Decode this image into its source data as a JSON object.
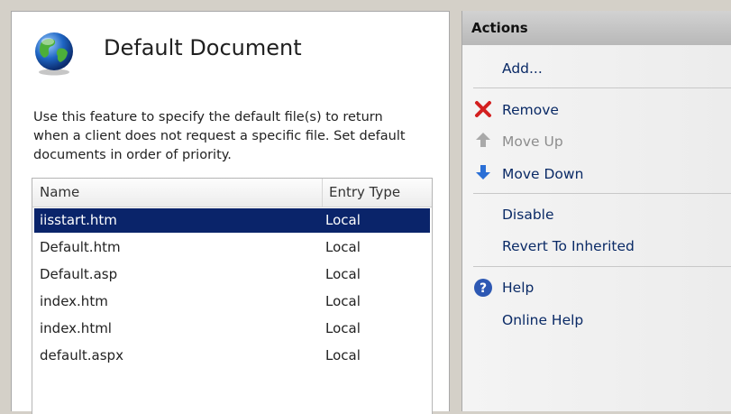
{
  "feature": {
    "title": "Default Document",
    "description_lines": [
      "Use this feature to specify the default file(s) to return",
      "when a client does not request a specific file. Set default",
      "documents in order of priority."
    ],
    "icon": "globe-icon"
  },
  "table": {
    "columns": [
      "Name",
      "Entry Type"
    ],
    "rows": [
      {
        "name": "iisstart.htm",
        "type": "Local"
      },
      {
        "name": "Default.htm",
        "type": "Local"
      },
      {
        "name": "Default.asp",
        "type": "Local"
      },
      {
        "name": "index.htm",
        "type": "Local"
      },
      {
        "name": "index.html",
        "type": "Local"
      },
      {
        "name": "default.aspx",
        "type": "Local"
      }
    ],
    "selected_row": 0
  },
  "actions": {
    "header": "Actions",
    "items": [
      {
        "label": "Add...",
        "icon": ""
      },
      {
        "label": "Remove",
        "icon": "red-x-icon"
      },
      {
        "label": "Move Up",
        "icon": "arrow-up-icon",
        "disabled": true
      },
      {
        "label": "Move Down",
        "icon": "arrow-down-icon"
      },
      {
        "label": "Disable",
        "icon": ""
      },
      {
        "label": "Revert To Inherited",
        "icon": ""
      },
      {
        "label": "Help",
        "icon": "help-icon"
      },
      {
        "label": "Online Help",
        "icon": ""
      }
    ]
  },
  "colors": {
    "selection": "#0a246a",
    "link": "#0a2a66",
    "disabled": "#8d8d8d",
    "remove": "#d32020",
    "move_down": "#2a6fd6"
  }
}
